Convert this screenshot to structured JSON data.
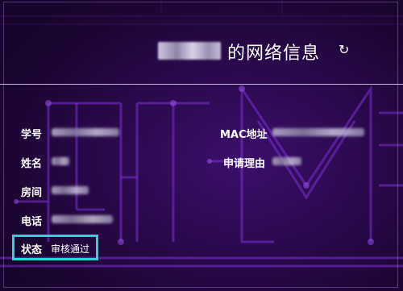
{
  "header": {
    "title_suffix": "的网络信息",
    "refresh_icon": "↻"
  },
  "fields": {
    "student_id_label": "学号",
    "name_label": "姓名",
    "room_label": "房间",
    "phone_label": "电话",
    "mac_label": "MAC地址",
    "reason_label": "申请理由"
  },
  "status": {
    "label": "状态",
    "value": "审核通过",
    "highlight_color": "#2dd1d8"
  },
  "colors": {
    "background": "#1c0634",
    "circuit": "#7a2fd0"
  }
}
